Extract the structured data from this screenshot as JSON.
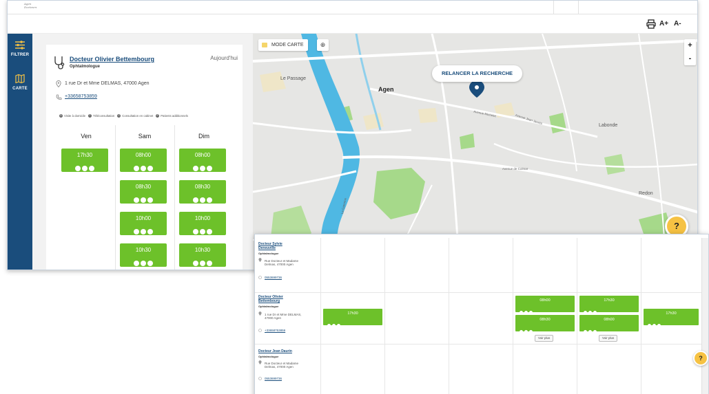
{
  "logo_text": [
    "Agen",
    "Docteurs"
  ],
  "toolbar": {
    "font_increase": "A+",
    "font_decrease": "A-"
  },
  "sidebar": [
    {
      "label": "FILTRER",
      "icon": "filter-icon"
    },
    {
      "label": "CARTE",
      "icon": "map-icon"
    }
  ],
  "card": {
    "name": "Docteur Olivier Bettembourg",
    "specialty": "Ophtalmologue",
    "day_label": "Aujourd'hui",
    "address": "1 rue Dr et Mme DELMAS, 47000 Agen",
    "phone": "+33658753859"
  },
  "legend": [
    {
      "letter": "D",
      "text": "Visite à domicile"
    },
    {
      "letter": "T",
      "text": "Téléconsultation"
    },
    {
      "letter": "C",
      "text": "Consultation en cabinet"
    },
    {
      "letter": "P",
      "text": "Patients additionnels"
    }
  ],
  "days": [
    {
      "name": "Ven",
      "slots": [
        "17h30"
      ]
    },
    {
      "name": "Sam",
      "slots": [
        "08h00",
        "08h30",
        "10h00",
        "10h30"
      ]
    },
    {
      "name": "Dim",
      "slots": [
        "08h00",
        "08h30",
        "10h00",
        "10h30"
      ]
    }
  ],
  "map": {
    "mode_label": "MODE CARTE",
    "relaunch_label": "RELANCER LA RECHERCHE",
    "zoom_in": "+",
    "zoom_out": "-",
    "places": [
      "Le Passage",
      "Agen",
      "Labonde",
      "Redon"
    ],
    "streets": [
      "Avenue Michelet",
      "Avenue Jean Jaurès",
      "Avenue de Colmar",
      "La Garonne"
    ],
    "colors": {
      "water": "#4fb8e3",
      "park": "#a6d98a",
      "land": "#e5e5e5",
      "marker": "#1a4d7c"
    }
  },
  "help_label": "?",
  "doctors_list": [
    {
      "name": "Docteur Sylvie Deneuville",
      "specialty": "Ophtalmologue",
      "address": "Rue Docteur et Madame Delmas, 47000 Agen",
      "phone": "0553699736"
    },
    {
      "name": "Docteur Olivier Bettembourg",
      "specialty": "Ophtalmologue",
      "address": "1 rue Dr et Mme DELMAS, 47000 Agen",
      "phone": "+33658753859",
      "slot_a": "17h30",
      "slot_b": "08h00",
      "slot_c": "08h30",
      "slot_d": "17h30",
      "slot_e": "08h00",
      "slot_f": "17h30"
    },
    {
      "name": "Docteur Jean Daurin",
      "specialty": "Ophtalmologue",
      "address": "Rue Docteur et Madame Delmas, 47000 Agen",
      "phone": "0553699736"
    }
  ],
  "voir_plus": "Voir plus",
  "accent": {
    "primary": "#1a4d7c",
    "slot": "#6dc12a",
    "help": "#f6c243"
  }
}
